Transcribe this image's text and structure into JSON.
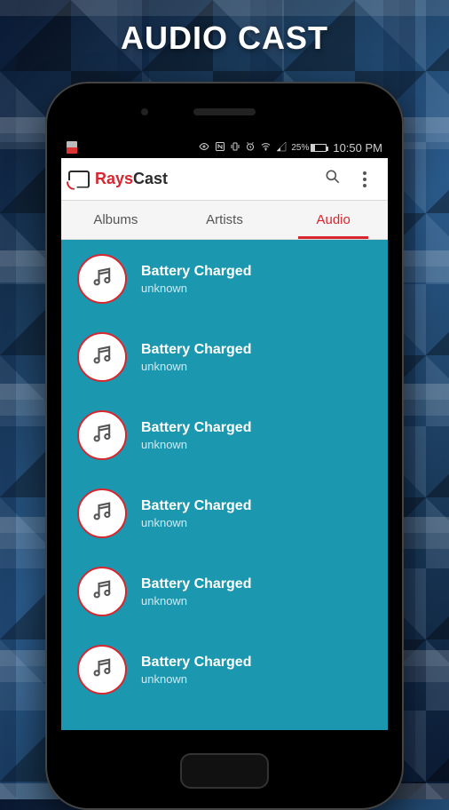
{
  "promo_title": "AUDIO CAST",
  "statusbar": {
    "battery_pct": "25%",
    "time": "10:50 PM"
  },
  "header": {
    "brand_prefix": "Rays",
    "brand_suffix": "Cast"
  },
  "tabs": [
    {
      "label": "Albums",
      "active": false
    },
    {
      "label": "Artists",
      "active": false
    },
    {
      "label": "Audio",
      "active": true
    }
  ],
  "audio_list": [
    {
      "title": "Battery Charged",
      "subtitle": "unknown"
    },
    {
      "title": "Battery Charged",
      "subtitle": "unknown"
    },
    {
      "title": "Battery Charged",
      "subtitle": "unknown"
    },
    {
      "title": "Battery Charged",
      "subtitle": "unknown"
    },
    {
      "title": "Battery Charged",
      "subtitle": "unknown"
    },
    {
      "title": "Battery Charged",
      "subtitle": "unknown"
    }
  ],
  "battery_fill_pct": 25
}
